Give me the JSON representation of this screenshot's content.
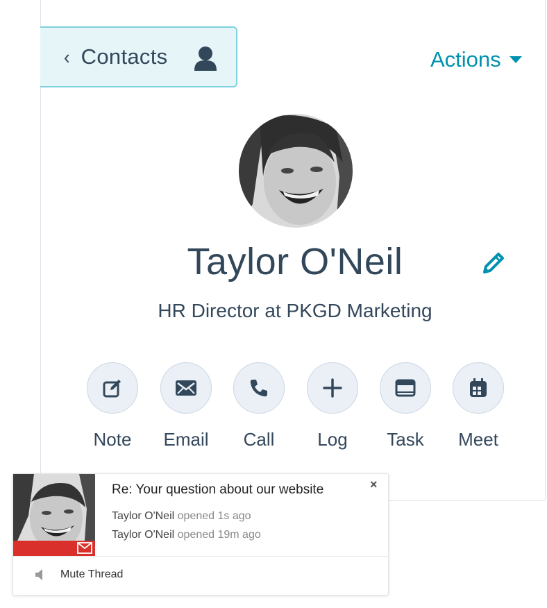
{
  "nav": {
    "back_label": "Contacts",
    "actions_label": "Actions"
  },
  "contact": {
    "name": "Taylor O'Neil",
    "title": "HR Director at PKGD Marketing"
  },
  "activity_buttons": [
    {
      "label": "Note",
      "icon": "note-icon"
    },
    {
      "label": "Email",
      "icon": "email-icon"
    },
    {
      "label": "Call",
      "icon": "call-icon"
    },
    {
      "label": "Log",
      "icon": "plus-icon"
    },
    {
      "label": "Task",
      "icon": "task-icon"
    },
    {
      "label": "Meet",
      "icon": "calendar-icon"
    }
  ],
  "notification": {
    "subject": "Re: Your question about our website",
    "close": "×",
    "events": [
      {
        "who": "Taylor O'Neil",
        "what": "opened 1s ago"
      },
      {
        "who": "Taylor O'Neil",
        "what": "opened 19m ago"
      }
    ],
    "mute_label": "Mute Thread"
  },
  "colors": {
    "accent": "#0091ae",
    "text": "#33475b",
    "button_bg": "#eaf0f6",
    "back_bg": "#e5f5f8",
    "notif_red": "#d9302c"
  }
}
